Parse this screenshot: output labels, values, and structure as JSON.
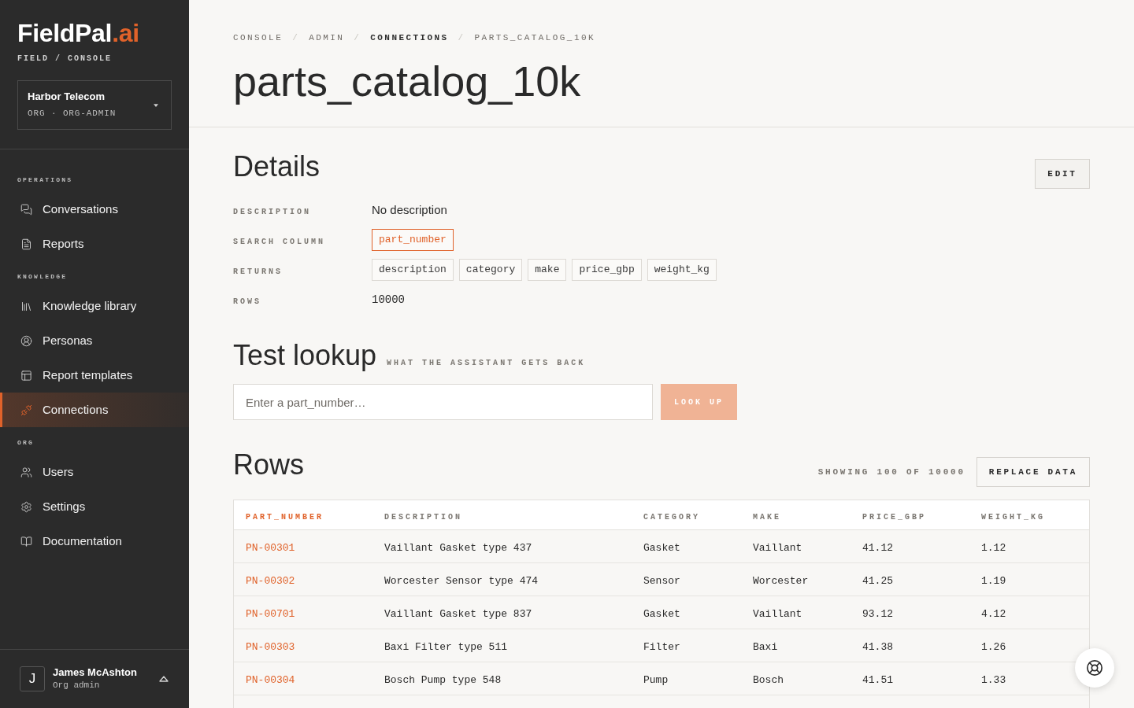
{
  "sidebar": {
    "logo": {
      "name": "FieldPal",
      "suffix": ".ai"
    },
    "tagline": "FIELD / CONSOLE",
    "org": {
      "name": "Harbor Telecom",
      "meta": "ORG · ORG-ADMIN"
    },
    "sections": [
      {
        "label": "OPERATIONS",
        "items": [
          {
            "label": "Conversations",
            "selected": false
          },
          {
            "label": "Reports",
            "selected": false
          }
        ]
      },
      {
        "label": "KNOWLEDGE",
        "items": [
          {
            "label": "Knowledge library",
            "selected": false
          },
          {
            "label": "Personas",
            "selected": false
          },
          {
            "label": "Report templates",
            "selected": false
          },
          {
            "label": "Connections",
            "selected": true
          }
        ]
      },
      {
        "label": "ORG",
        "items": [
          {
            "label": "Users",
            "selected": false
          },
          {
            "label": "Settings",
            "selected": false
          },
          {
            "label": "Documentation",
            "selected": false
          }
        ]
      }
    ],
    "user": {
      "initial": "J",
      "name": "James McAshton",
      "role": "Org admin",
      "expanded": false
    }
  },
  "breadcrumb": {
    "separator": "/",
    "items": [
      {
        "label": "CONSOLE",
        "active": false
      },
      {
        "label": "ADMIN",
        "active": false
      },
      {
        "label": "CONNECTIONS",
        "active": true
      },
      {
        "label": "PARTS_CATALOG_10K",
        "active": false
      }
    ]
  },
  "title": "parts_catalog_10k",
  "details": {
    "heading": "Details",
    "edit_button": "EDIT",
    "fields": [
      {
        "kind": "text",
        "label": "DESCRIPTION",
        "value": "No description"
      },
      {
        "kind": "key_chip",
        "label": "SEARCH COLUMN",
        "value": "part_number"
      },
      {
        "kind": "chips",
        "label": "RETURNS",
        "values": [
          "description",
          "category",
          "make",
          "price_gbp",
          "weight_kg"
        ]
      },
      {
        "kind": "number",
        "label": "ROWS",
        "value": "10000"
      }
    ]
  },
  "test_lookup": {
    "heading": "Test lookup",
    "subheading": "WHAT THE ASSISTANT GETS BACK",
    "input": {
      "placeholder": "Enter a part_number…"
    },
    "button": {
      "label": "LOOK UP",
      "disabled": true
    }
  },
  "rows": {
    "heading": "Rows",
    "count": "SHOWING 100 OF 10000",
    "button": "REPLACE DATA",
    "table": {
      "columns": [
        {
          "label": "PART_NUMBER",
          "search_key": true
        },
        {
          "label": "DESCRIPTION",
          "search_key": false
        },
        {
          "label": "CATEGORY",
          "search_key": false
        },
        {
          "label": "MAKE",
          "search_key": false
        },
        {
          "label": "PRICE_GBP",
          "search_key": false
        },
        {
          "label": "WEIGHT_KG",
          "search_key": false
        }
      ],
      "rows": [
        [
          "PN-00301",
          "Vaillant Gasket type 437",
          "Gasket",
          "Vaillant",
          "41.12",
          "1.12"
        ],
        [
          "PN-00302",
          "Worcester Sensor type 474",
          "Sensor",
          "Worcester",
          "41.25",
          "1.19"
        ],
        [
          "PN-00701",
          "Vaillant Gasket type 837",
          "Gasket",
          "Vaillant",
          "93.12",
          "4.12"
        ],
        [
          "PN-00303",
          "Baxi Filter type 511",
          "Filter",
          "Baxi",
          "41.38",
          "1.26"
        ],
        [
          "PN-00304",
          "Bosch Pump type 548",
          "Pump",
          "Bosch",
          "41.51",
          "1.33"
        ]
      ]
    }
  }
}
